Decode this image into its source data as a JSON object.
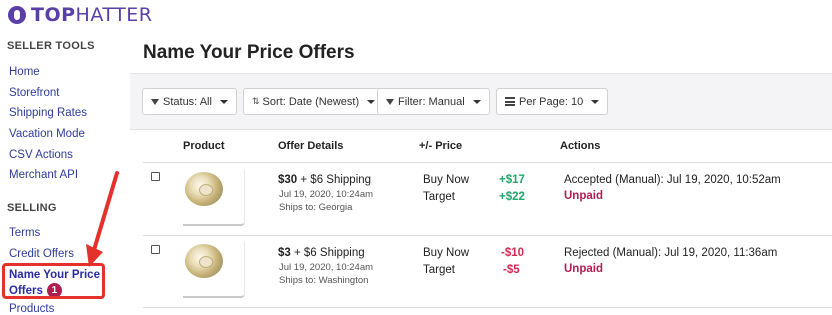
{
  "brand": {
    "name_bold": "TOP",
    "name_rest": "HATTER",
    "color": "#5a3fa8"
  },
  "sidebar": {
    "seller_tools_heading": "SELLER TOOLS",
    "seller_tools": [
      "Home",
      "Storefront",
      "Shipping Rates",
      "Vacation Mode",
      "CSV Actions",
      "Merchant API"
    ],
    "selling_heading": "SELLING",
    "selling": [
      "Terms",
      "Credit Offers"
    ],
    "active_item": {
      "line1": "Name Your Price",
      "line2": "Offers",
      "badge": "1"
    },
    "after_active": [
      "Products"
    ]
  },
  "page": {
    "title": "Name Your Price Offers"
  },
  "filters": {
    "status": "Status: All",
    "sort": "Sort: Date (Newest)",
    "filter": "Filter: Manual",
    "per_page": "Per Page: 10"
  },
  "table": {
    "headers": {
      "product": "Product",
      "offer": "Offer Details",
      "price": "+/- Price",
      "actions": "Actions"
    },
    "rows": [
      {
        "offer_amount": "$30",
        "shipping": "+ $6 Shipping",
        "date": "Jul 19, 2020, 10:24am",
        "ships_to": "Ships to: Georgia",
        "buy_now_label": "Buy Now",
        "buy_now_diff": "+$17",
        "target_label": "Target",
        "target_diff": "+$22",
        "status": "Accepted (Manual): Jul 19, 2020, 10:52am",
        "payment": "Unpaid"
      },
      {
        "offer_amount": "$3",
        "shipping": "+ $6 Shipping",
        "date": "Jul 19, 2020, 10:24am",
        "ships_to": "Ships to: Washington",
        "buy_now_label": "Buy Now",
        "buy_now_diff": "-$10",
        "target_label": "Target",
        "target_diff": "-$5",
        "status": "Rejected (Manual): Jul 19, 2020, 11:36am",
        "payment": "Unpaid"
      }
    ]
  },
  "colors": {
    "positive": "#1fa86a",
    "negative": "#d22b52",
    "unpaid": "#b01e4f",
    "annotation": "#e4312b",
    "link": "#2f3d9b"
  }
}
